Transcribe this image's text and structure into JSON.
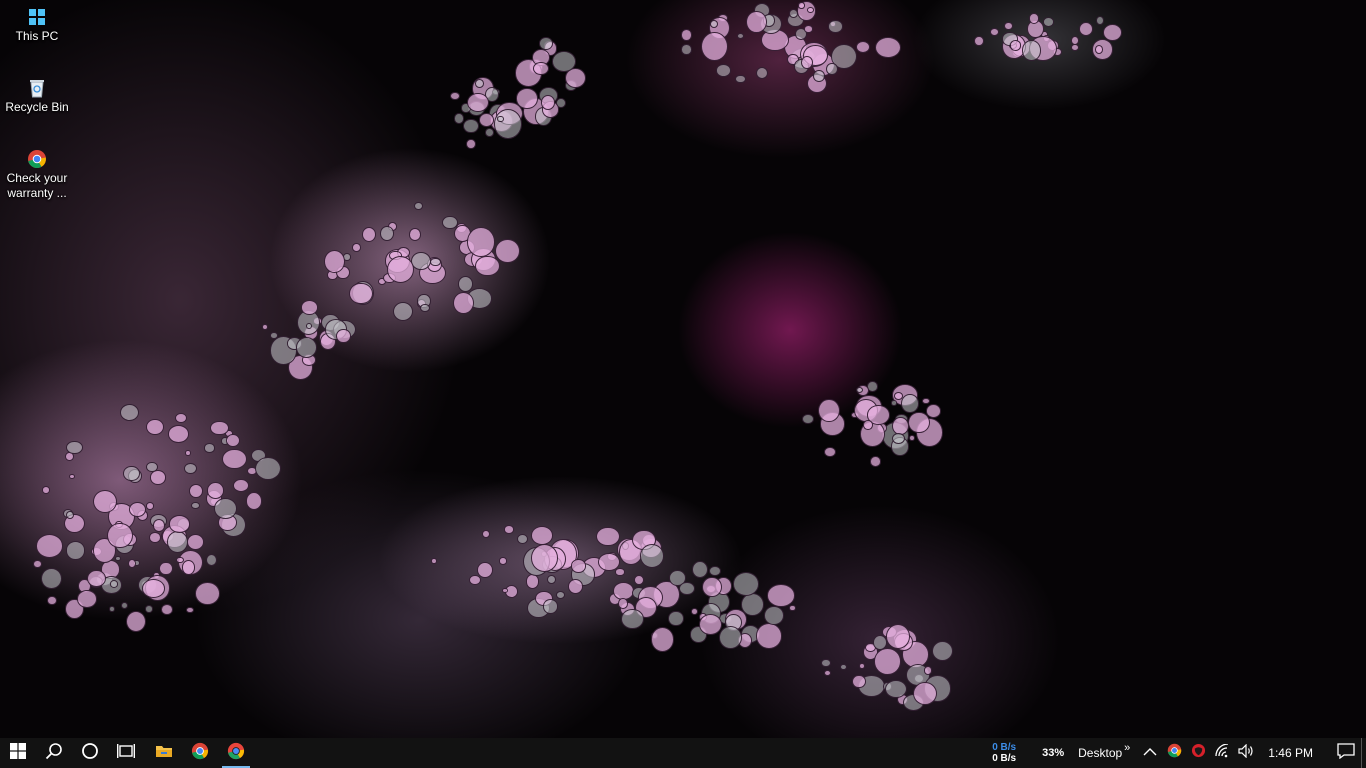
{
  "desktop": {
    "icons": [
      {
        "label": "This PC",
        "icon": "this-pc-icon"
      },
      {
        "label": "Recycle Bin",
        "icon": "recycle-bin-icon"
      },
      {
        "label": "Check your warranty ...",
        "icon": "chrome-icon"
      }
    ]
  },
  "taskbar": {
    "start": {
      "icon": "windows-logo-icon"
    },
    "search": {
      "icon": "search-icon"
    },
    "cortana": {
      "icon": "cortana-circle-icon"
    },
    "task_view": {
      "icon": "task-view-icon"
    },
    "pinned": [
      {
        "name": "File Explorer",
        "icon": "folder-icon"
      },
      {
        "name": "Google Chrome",
        "icon": "chrome-icon"
      },
      {
        "name": "Chrome Canary",
        "icon": "chrome-canary-icon",
        "active": true
      }
    ],
    "tray": {
      "net_upload": "0 B/s",
      "net_download": "0 B/s",
      "battery_percent": "33%",
      "desktop_toolbar": "Desktop",
      "overflow_chevron": "»",
      "show_hidden_icon": "chevron-up-icon",
      "clock": "1:46 PM",
      "notifications_icon": "action-center-icon"
    }
  },
  "colors": {
    "taskbar_bg": "#121212",
    "accent": "#76b9ed",
    "net_up": "#3c8ce6"
  }
}
